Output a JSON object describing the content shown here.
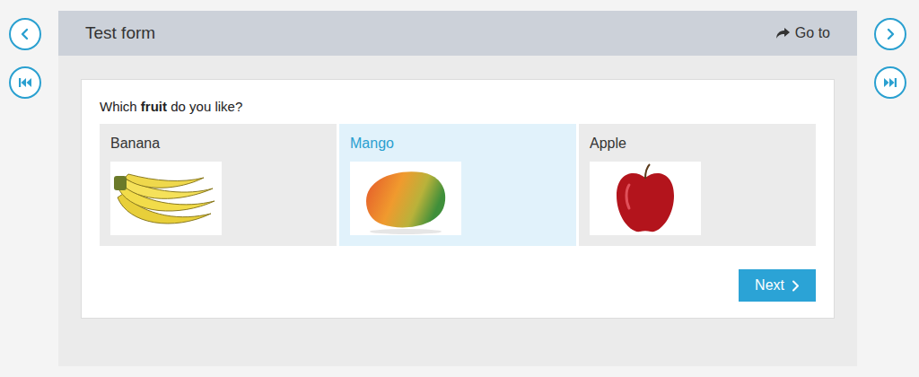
{
  "header": {
    "title": "Test form",
    "goto": "Go to"
  },
  "question": {
    "parts": [
      {
        "text": "Which ",
        "bold": false
      },
      {
        "text": "fruit",
        "bold": true
      },
      {
        "text": " do you like?",
        "bold": false
      }
    ]
  },
  "options": [
    {
      "label": "Banana",
      "selected": false
    },
    {
      "label": "Mango",
      "selected": true
    },
    {
      "label": "Apple",
      "selected": false
    }
  ],
  "next_button": {
    "label": "Next"
  }
}
